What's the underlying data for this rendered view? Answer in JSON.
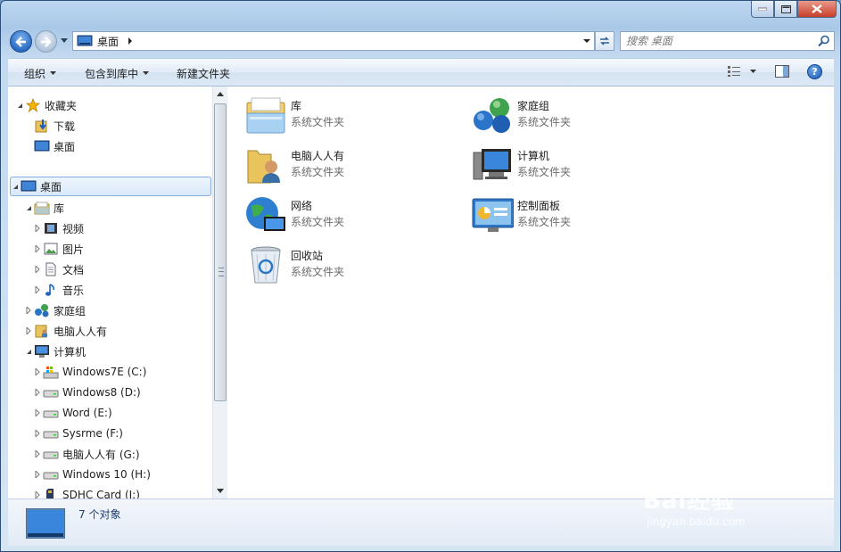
{
  "address": {
    "location": "桌面"
  },
  "search": {
    "placeholder": "搜索 桌面"
  },
  "toolbar": {
    "organize": "组织",
    "include_in_library": "包含到库中",
    "new_folder": "新建文件夹"
  },
  "nav": {
    "favorites": "收藏夹",
    "downloads": "下载",
    "fav_desktop": "桌面",
    "desktop": "桌面",
    "libraries": "库",
    "videos": "视频",
    "pictures": "图片",
    "documents": "文档",
    "music": "音乐",
    "homegroup": "家庭组",
    "user": "电脑人人有",
    "computer": "计算机",
    "drives": [
      "Windows7E (C:)",
      "Windows8 (D:)",
      "Word (E:)",
      "Sysrme (F:)",
      "电脑人人有 (G:)",
      "Windows 10 (H:)",
      "SDHC Card (I:)"
    ]
  },
  "items": [
    {
      "name": "库",
      "type": "系统文件夹"
    },
    {
      "name": "家庭组",
      "type": "系统文件夹"
    },
    {
      "name": "电脑人人有",
      "type": "系统文件夹"
    },
    {
      "name": "计算机",
      "type": "系统文件夹"
    },
    {
      "name": "网络",
      "type": "系统文件夹"
    },
    {
      "name": "控制面板",
      "type": "系统文件夹"
    },
    {
      "name": "回收站",
      "type": "系统文件夹"
    }
  ],
  "status": {
    "count": "7 个对象"
  },
  "watermark": {
    "brand": "Bai经验",
    "url": "jingyan.baidu.com"
  }
}
